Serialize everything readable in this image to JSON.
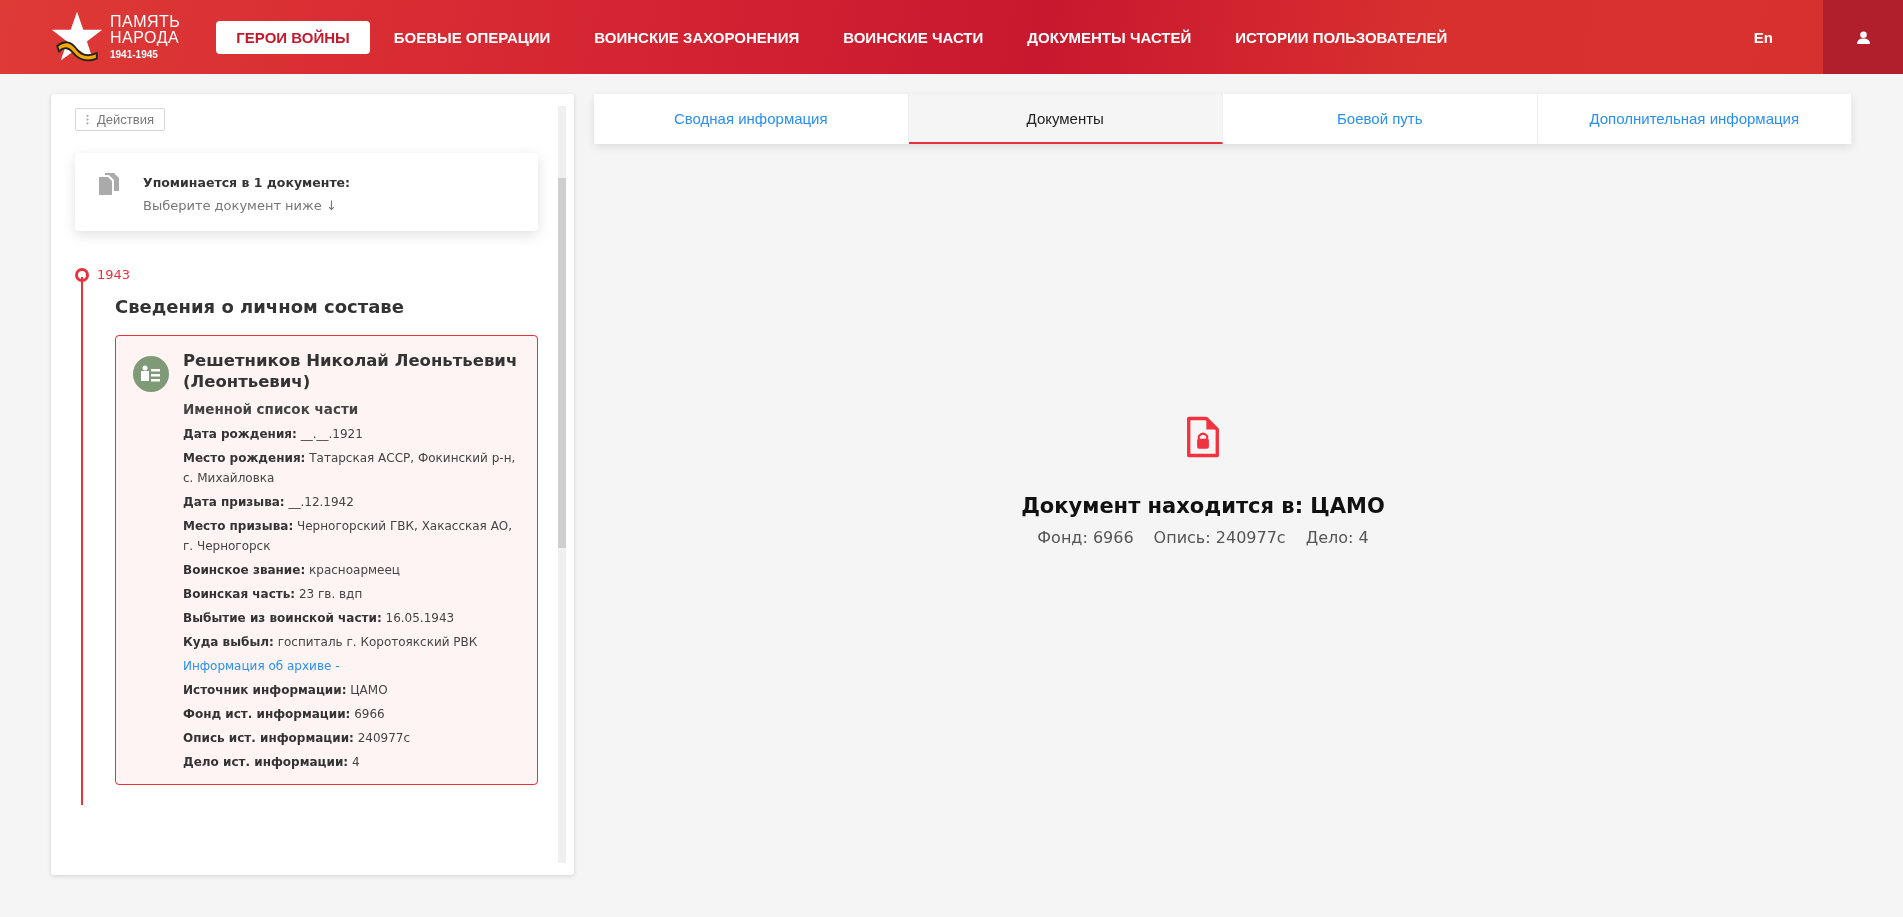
{
  "header": {
    "logo": {
      "line1": "ПАМЯТЬ",
      "line2": "НАРОДА",
      "years": "1941-1945"
    },
    "nav": [
      {
        "label": "ГЕРОИ ВОЙНЫ",
        "selected": true
      },
      {
        "label": "БОЕВЫЕ ОПЕРАЦИИ",
        "selected": false
      },
      {
        "label": "ВОИНСКИЕ ЗАХОРОНЕНИЯ",
        "selected": false
      },
      {
        "label": "ВОИНСКИЕ ЧАСТИ",
        "selected": false
      },
      {
        "label": "ДОКУМЕНТЫ ЧАСТЕЙ",
        "selected": false
      },
      {
        "label": "ИСТОРИИ ПОЛЬЗОВАТЕЛЕЙ",
        "selected": false
      }
    ],
    "language": "En"
  },
  "sidebar": {
    "actions_button": "Действия",
    "mentions": {
      "title": "Упоминается в 1 документе:",
      "hint": "Выберите документ ниже ↓"
    },
    "timeline": {
      "year": "1943",
      "section_title": "Сведения о личном составе",
      "record": {
        "name": "Решетников Николай Леоньтьевич (Леонтьевич)",
        "rows": [
          {
            "kind": "subtitle",
            "text": "Именной список части"
          },
          {
            "kind": "field",
            "text": "**Дата рождения:** __.__.1921"
          },
          {
            "kind": "field",
            "text": "**Место рождения:** Татарская АССР, Фокинский р-н, с. Михайловка"
          },
          {
            "kind": "field",
            "text": "**Дата призыва:** __.12.1942"
          },
          {
            "kind": "field",
            "text": "**Место призыва:** Черногорский ГВК, Хакасская АО, г. Черногорск"
          },
          {
            "kind": "field",
            "text": "**Воинское звание:** красноармеец"
          },
          {
            "kind": "field",
            "text": "**Воинская часть:** 23 гв. вдп"
          },
          {
            "kind": "field",
            "text": "**Выбытие из воинской части:** 16.05.1943"
          },
          {
            "kind": "field",
            "text": "**Куда выбыл:** госпиталь г. Коротоякский РВК"
          },
          {
            "kind": "link",
            "text": "Информация об архиве -"
          },
          {
            "kind": "field",
            "text": "**Источник информации:** ЦАМО"
          },
          {
            "kind": "field",
            "text": "**Фонд ист. информации:** 6966"
          },
          {
            "kind": "field",
            "text": "**Опись ист. информации:** 240977с"
          },
          {
            "kind": "field",
            "text": "**Дело ист. информации:** 4"
          }
        ]
      }
    }
  },
  "tabs": [
    {
      "label": "Сводная информация",
      "selected": false
    },
    {
      "label": "Документы",
      "selected": true
    },
    {
      "label": "Боевой путь",
      "selected": false
    },
    {
      "label": "Дополнительная информация",
      "selected": false
    }
  ],
  "document": {
    "title": "Документ находится в: ЦАМО",
    "details": [
      "Фонд: 6966",
      "Опись: 240977с",
      "Дело: 4"
    ]
  }
}
